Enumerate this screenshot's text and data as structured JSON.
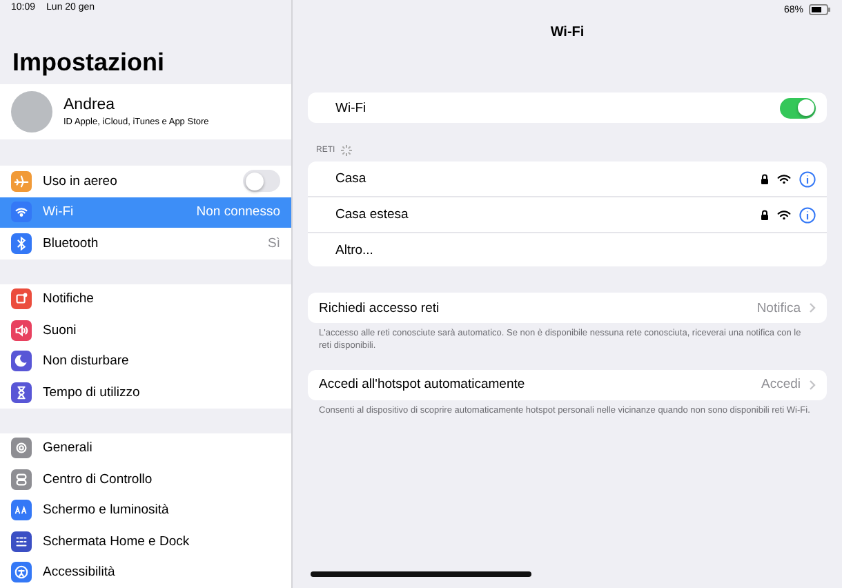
{
  "status_bar": {
    "time": "10:09",
    "date": "Lun 20 gen",
    "battery": "68%"
  },
  "sidebar": {
    "title": "Impostazioni",
    "profile": {
      "name": "Andrea",
      "subtitle": "ID Apple, iCloud, iTunes e App Store"
    },
    "groups": [
      [
        {
          "label": "Uso in aereo",
          "kind": "toggle",
          "on": false,
          "selected": false,
          "color": "#f19a37"
        },
        {
          "label": "Wi-Fi",
          "kind": "value",
          "value": "Non connesso",
          "selected": true,
          "color": "#3478f6"
        },
        {
          "label": "Bluetooth",
          "kind": "value",
          "value": "Sì",
          "selected": false,
          "color": "#3478f6"
        }
      ],
      [
        {
          "label": "Notifiche",
          "kind": "plain",
          "selected": false,
          "color": "#eb4d3d"
        },
        {
          "label": "Suoni",
          "kind": "plain",
          "selected": false,
          "color": "#e8415f"
        },
        {
          "label": "Non disturbare",
          "kind": "plain",
          "selected": false,
          "color": "#5856d6"
        },
        {
          "label": "Tempo di utilizzo",
          "kind": "plain",
          "selected": false,
          "color": "#5856d6"
        }
      ],
      [
        {
          "label": "Generali",
          "kind": "plain",
          "selected": false,
          "color": "#8e8e93"
        },
        {
          "label": "Centro di Controllo",
          "kind": "plain",
          "selected": false,
          "color": "#8e8e93"
        },
        {
          "label": "Schermo e luminosità",
          "kind": "plain",
          "selected": false,
          "color": "#3478f6"
        },
        {
          "label": "Schermata Home e Dock",
          "kind": "plain",
          "selected": false,
          "color": "#3b4fc4"
        },
        {
          "label": "Accessibilità",
          "kind": "plain",
          "selected": false,
          "color": "#3478f6"
        }
      ]
    ]
  },
  "detail": {
    "title": "Wi-Fi",
    "wifi": {
      "label": "Wi-Fi",
      "on": true
    },
    "networks_header": "RETI",
    "networks": [
      {
        "name": "Casa",
        "locked": true
      },
      {
        "name": "Casa estesa",
        "locked": true
      }
    ],
    "other": "Altro...",
    "settings": [
      {
        "label": "Richiedi accesso reti",
        "value": "Notifica",
        "footer": "L'accesso alle reti conosciute sarà automatico. Se non è disponibile nessuna rete conosciuta, riceverai una notifica con le reti disponibili."
      },
      {
        "label": "Accedi all'hotspot automaticamente",
        "value": "Accedi",
        "footer": "Consenti al dispositivo di scoprire automaticamente hotspot personali nelle vicinanze quando non sono disponibili reti Wi-Fi."
      }
    ]
  }
}
